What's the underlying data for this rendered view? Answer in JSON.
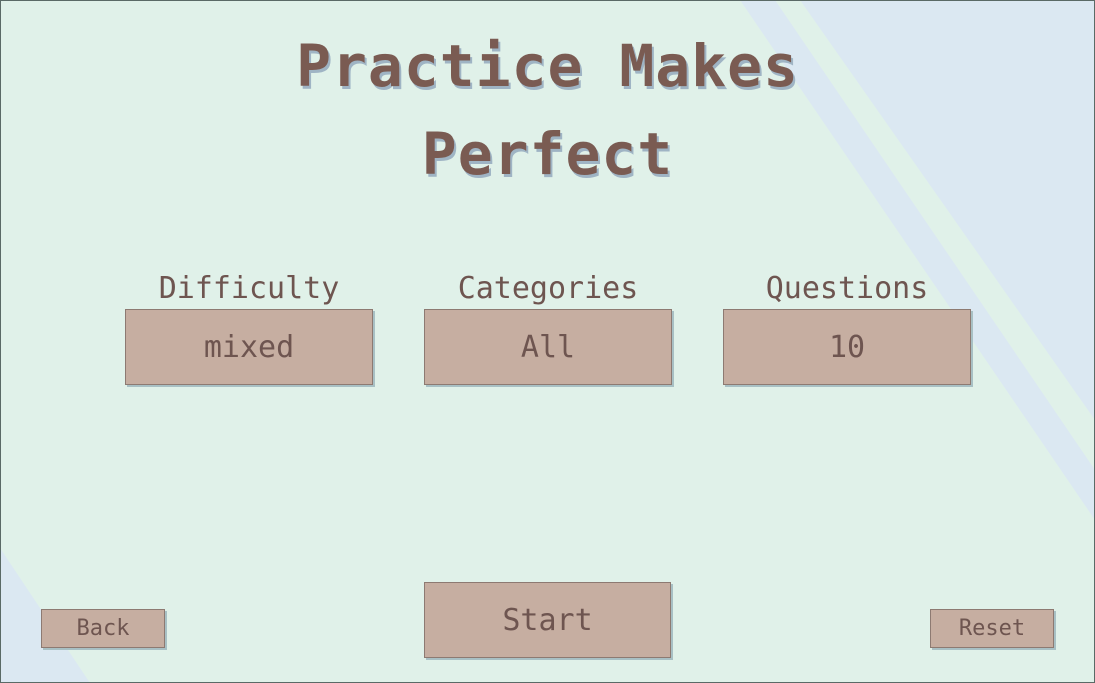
{
  "title": {
    "line1": "Practice Makes",
    "line2": "Perfect"
  },
  "settings": {
    "difficulty": {
      "label": "Difficulty",
      "value": "mixed"
    },
    "categories": {
      "label": "Categories",
      "value": "All"
    },
    "questions": {
      "label": "Questions",
      "value": "10"
    }
  },
  "actions": {
    "back_label": "Back",
    "start_label": "Start",
    "reset_label": "Reset"
  },
  "colors": {
    "background": "#e0f1e9",
    "stripe": "#dbe8f2",
    "button_fill": "#c6aea1",
    "text": "#6e5550",
    "title_shadow": "#9fb4c4"
  }
}
